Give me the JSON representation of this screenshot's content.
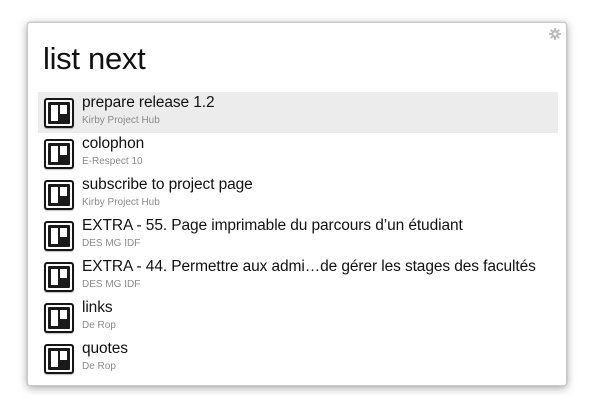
{
  "query": {
    "value": "list next"
  },
  "settings_icon": "gear-icon",
  "result_icon": "kanban-board-icon",
  "results": [
    {
      "title": "prepare release 1.2",
      "subtitle": "Kirby Project Hub",
      "selected": true
    },
    {
      "title": "colophon",
      "subtitle": "E-Respect 10",
      "selected": false
    },
    {
      "title": "subscribe to project page",
      "subtitle": "Kirby Project Hub",
      "selected": false
    },
    {
      "title": "EXTRA - 55. Page imprimable du parcours d’un étudiant",
      "subtitle": "DES MG IDF",
      "selected": false
    },
    {
      "title": "EXTRA - 44. Permettre aux admi…de gérer les stages des facultés",
      "subtitle": "DES MG IDF",
      "selected": false
    },
    {
      "title": "links",
      "subtitle": "De Rop",
      "selected": false
    },
    {
      "title": "quotes",
      "subtitle": "De Rop",
      "selected": false
    }
  ],
  "colors": {
    "selected_row": "#ececec",
    "title_text": "#111111",
    "subtitle_text": "#8a8a8a"
  }
}
